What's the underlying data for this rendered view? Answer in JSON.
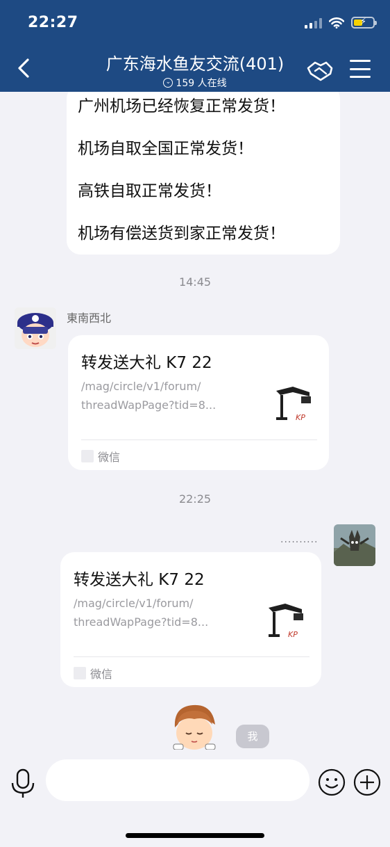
{
  "status_bar": {
    "time": "22:27"
  },
  "header": {
    "title": "广东海水鱼友交流(401)",
    "online_text": "159 人在线",
    "back_icon": "chevron-left-icon",
    "action_icon": "handshake-icon",
    "menu_icon": "hamburger-menu-icon"
  },
  "messages": {
    "announcement_lines": [
      "广州机场已经恢复正常发货！",
      "机场自取全国正常发货！",
      "高铁自取正常发货！",
      "机场有偿送货到家正常发货！"
    ],
    "time_1": "14:45",
    "sender_1": "東南西北",
    "card_1": {
      "title": "转发送大礼 K7 22",
      "desc_line1": "/mag/circle/v1/forum/",
      "desc_line2": "threadWapPage?tid=8...",
      "source": "微信"
    },
    "time_2": "22:25",
    "sending_dots": "..........",
    "card_2": {
      "title": "转发送大礼 K7 22",
      "desc_line1": "/mag/circle/v1/forum/",
      "desc_line2": "threadWapPage?tid=8...",
      "source": "微信"
    },
    "me_tag": "我"
  },
  "input_bar": {
    "placeholder": "",
    "mic_icon": "microphone-icon",
    "emoji_icon": "smiley-icon",
    "plus_icon": "plus-circle-icon"
  },
  "colors": {
    "header_bg": "#1e4a83",
    "chat_bg": "#f2f2f7",
    "bubble_bg": "#ffffff"
  }
}
